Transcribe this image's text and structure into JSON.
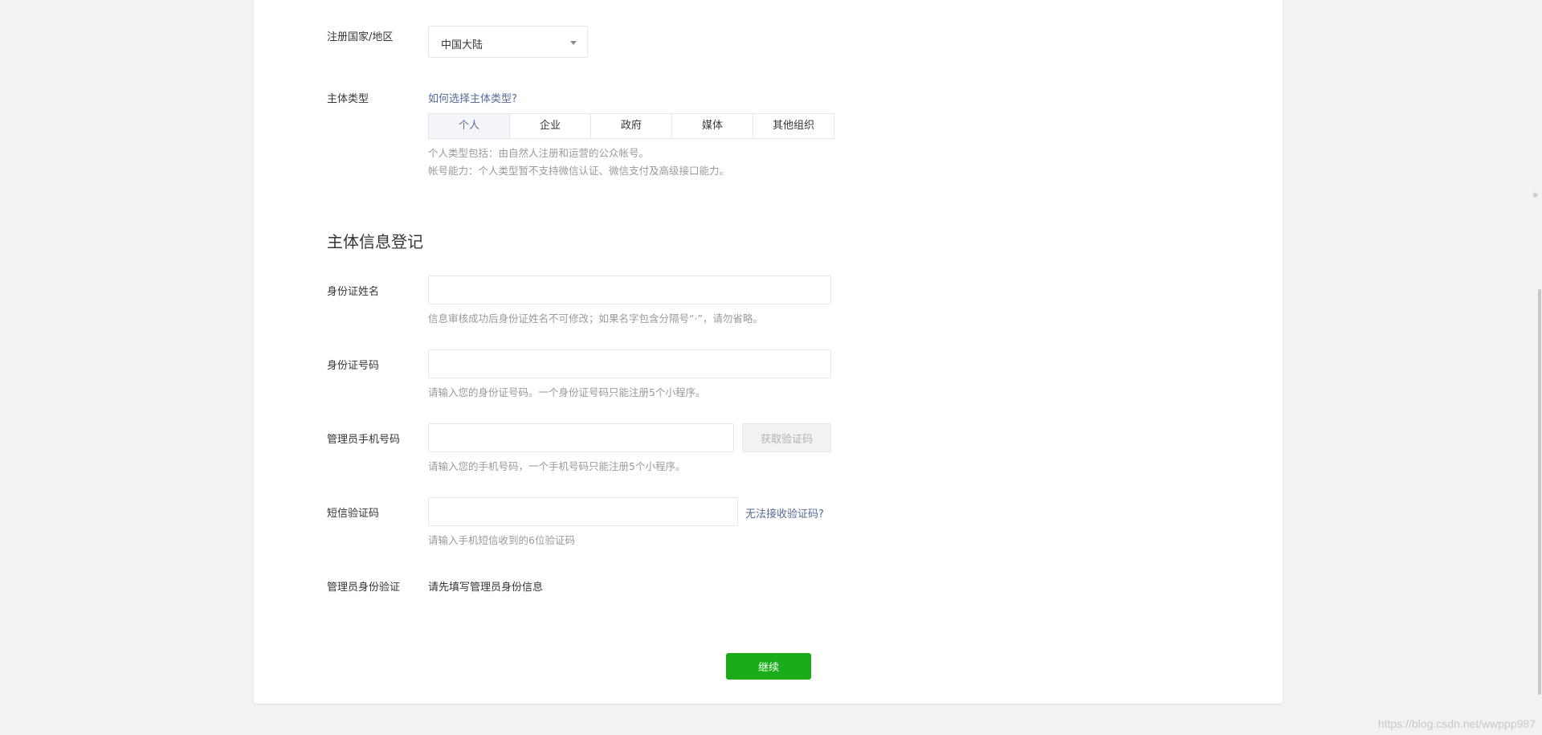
{
  "form": {
    "country_label": "注册国家/地区",
    "country_value": "中国大陆",
    "entity_type_label": "主体类型",
    "entity_type_help_link": "如何选择主体类型?",
    "entity_types": [
      "个人",
      "企业",
      "政府",
      "媒体",
      "其他组织"
    ],
    "entity_type_selected": "个人",
    "entity_tip_1": "个人类型包括：由自然人注册和运营的公众帐号。",
    "entity_tip_2": "帐号能力：个人类型暂不支持微信认证、微信支付及高级接口能力。",
    "section_title": "主体信息登记",
    "id_name_label": "身份证姓名",
    "id_name_value": "",
    "id_name_tip": "信息审核成功后身份证姓名不可修改；如果名字包含分隔号“·”，请勿省略。",
    "id_number_label": "身份证号码",
    "id_number_value": "",
    "id_number_tip": "请输入您的身份证号码。一个身份证号码只能注册5个小程序。",
    "phone_label": "管理员手机号码",
    "phone_value": "",
    "get_code_button": "获取验证码",
    "phone_tip": "请输入您的手机号码，一个手机号码只能注册5个小程序。",
    "sms_label": "短信验证码",
    "sms_value": "",
    "sms_help_link": "无法接收验证码?",
    "sms_tip": "请输入手机短信收到的6位验证码",
    "admin_verify_label": "管理员身份验证",
    "admin_verify_text": "请先填写管理员身份信息",
    "continue_button": "继续"
  },
  "watermark": "https://blog.csdn.net/wwppp987",
  "colors": {
    "primary_green": "#1aad19",
    "link_blue": "#576b95",
    "tip_gray": "#9a9a9a"
  }
}
